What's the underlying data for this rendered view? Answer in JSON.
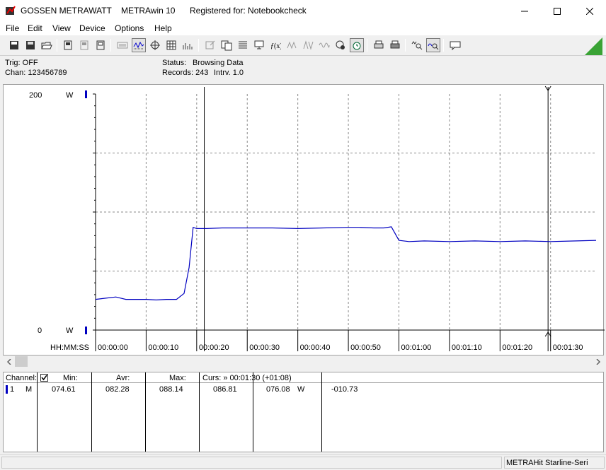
{
  "window": {
    "company": "GOSSEN METRAWATT",
    "app": "METRAwin 10",
    "registered": "Registered for: Notebookcheck"
  },
  "menu": {
    "file": "File",
    "edit": "Edit",
    "view": "View",
    "device": "Device",
    "options": "Options",
    "help": "Help"
  },
  "status": {
    "trig": "Trig: OFF",
    "chan": "Chan:  123456789",
    "status_label": "Status:",
    "status_value": "Browsing Data",
    "records_label": "Records: 243",
    "interval": "Intrv. 1.0"
  },
  "chart": {
    "ymax_label": "200",
    "ymin_label": "0",
    "unit": "W",
    "time_label": "HH:MM:SS",
    "accent": "#0000c0"
  },
  "chart_data": {
    "type": "line",
    "ylim": [
      0,
      200
    ],
    "x_ticks": [
      "00:00:00",
      "00:00:10",
      "00:00:20",
      "00:00:30",
      "00:00:40",
      "00:00:50",
      "00:01:00",
      "00:01:10",
      "00:01:20",
      "00:01:30"
    ],
    "xlim": [
      0,
      99
    ],
    "grid": true,
    "cursor_times": [
      21.5,
      89.5
    ],
    "series": [
      {
        "x": [
          0,
          2,
          4,
          6,
          8,
          10,
          12,
          14,
          16,
          17.5,
          18.5,
          19.3,
          20,
          22,
          25,
          30,
          35,
          40,
          45,
          50,
          52,
          55,
          57,
          58.5,
          60,
          62,
          65,
          70,
          75,
          80,
          85,
          90,
          95,
          99
        ],
        "y": [
          26,
          27,
          28,
          26,
          26,
          26,
          25.5,
          26,
          26,
          31,
          53,
          87,
          86,
          86,
          86.5,
          86.5,
          86.5,
          86,
          86.5,
          87,
          87,
          86.5,
          86.5,
          87.5,
          76,
          75,
          75.5,
          75,
          75.5,
          75,
          75.5,
          75,
          75.5,
          76
        ]
      }
    ]
  },
  "table": {
    "channel_label": "Channel:",
    "min_label": "Min:",
    "avg_label": "Avr:",
    "max_label": "Max:",
    "cursor_label": "Curs: » 00:01:30 (+01:08)",
    "row": {
      "num": "1",
      "mode": "M",
      "min": "074.61",
      "avg": "082.28",
      "max": "088.14",
      "c1": "086.81",
      "c2": "076.08",
      "unit": "W",
      "diff": "-010.73"
    }
  },
  "statusbar": {
    "device": "METRAHit Starline-Seri"
  }
}
